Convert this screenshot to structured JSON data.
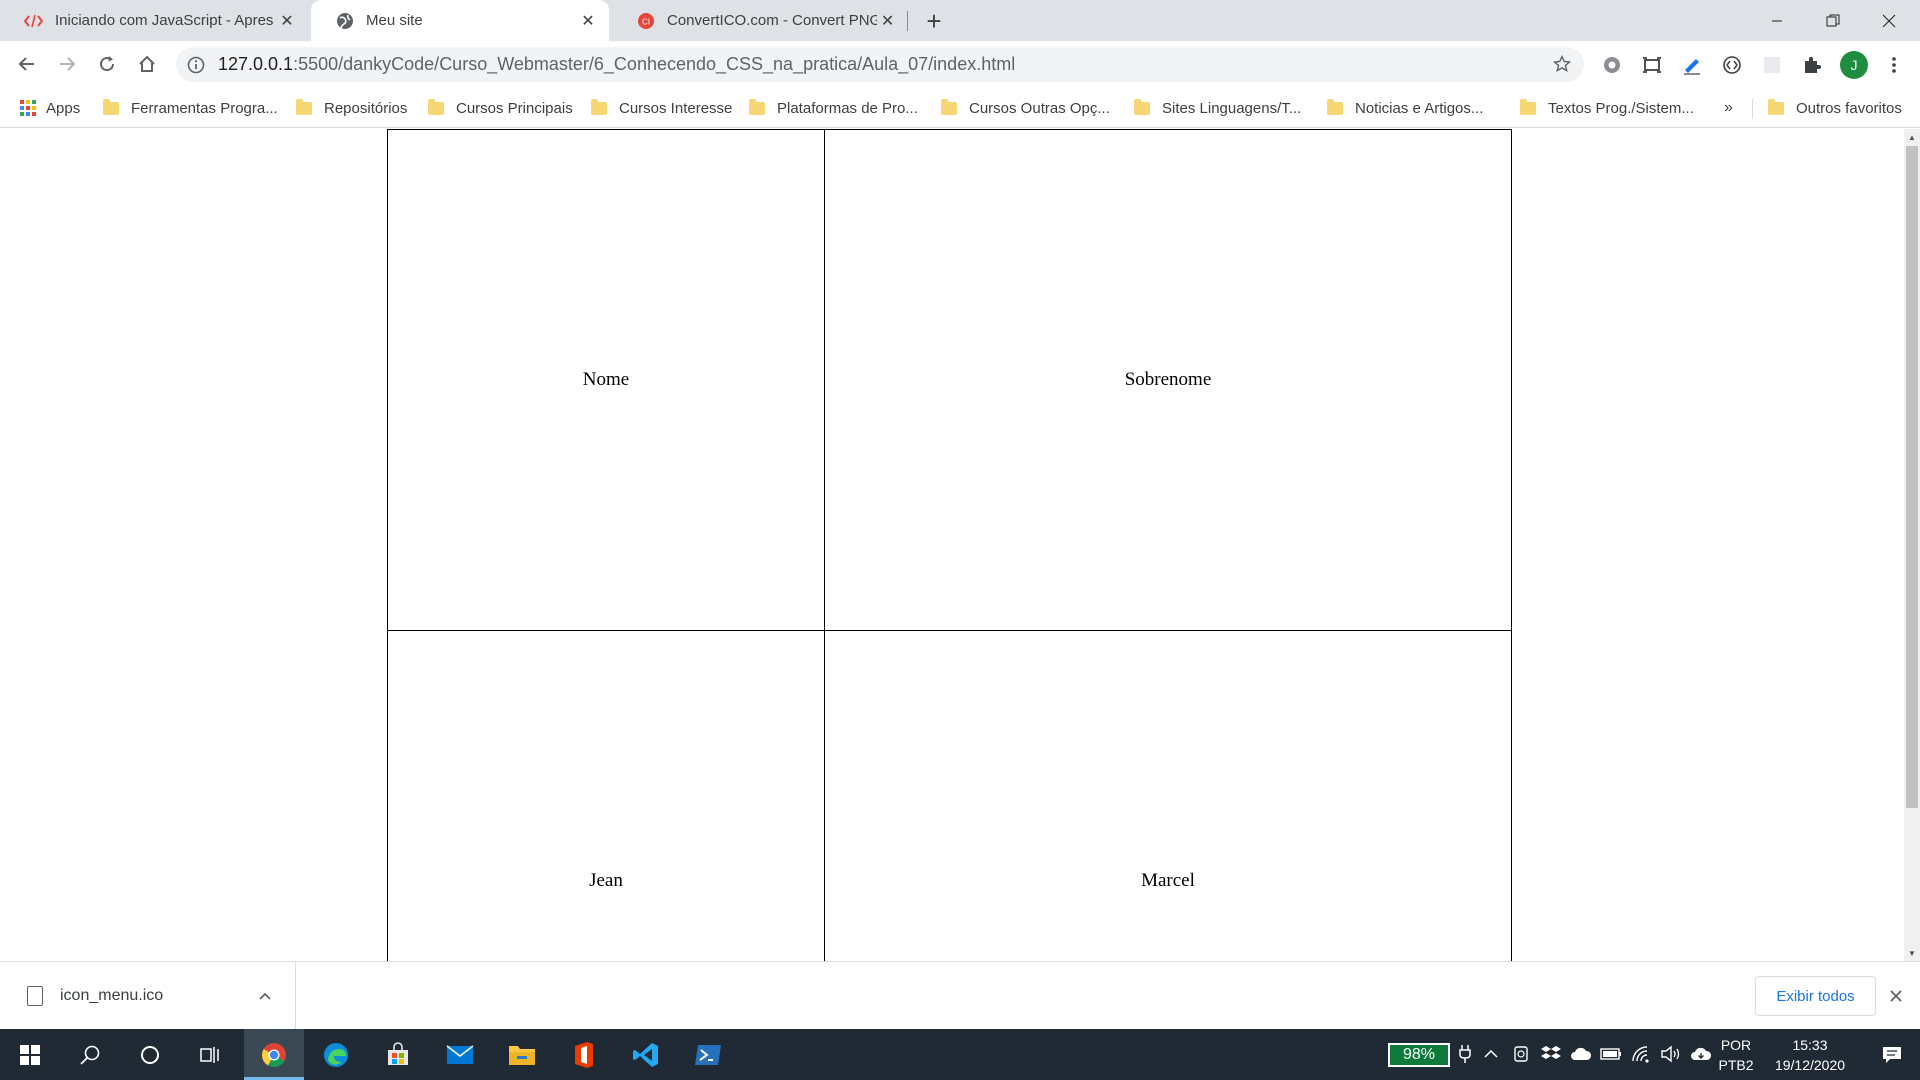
{
  "browser": {
    "tabs": [
      {
        "title": "Iniciando com JavaScript - Apres",
        "favicon": "code-brackets-icon",
        "active": false
      },
      {
        "title": "Meu site",
        "favicon": "globe-icon",
        "active": true
      },
      {
        "title": "ConvertICO.com - Convert PNG t",
        "favicon": "converticon-logo-icon",
        "active": false
      }
    ],
    "new_tab_label": "+",
    "url_host": "127.0.0.1",
    "url_rest": ":5500/dankyCode/Curso_Webmaster/6_Conhecendo_CSS_na_pratica/Aula_07/index.html",
    "profile_initial": "J",
    "bookmarks": {
      "apps_label": "Apps",
      "items": [
        "Ferramentas Progra...",
        "Repositórios",
        "Cursos Principais",
        "Cursos Interesse",
        "Plataformas de Pro...",
        "Cursos Outras Opç...",
        "Sites Linguagens/T...",
        "Noticias e Artigos...",
        "Textos Prog./Sistem..."
      ],
      "more_label": "»",
      "other_label": "Outros favoritos"
    }
  },
  "page": {
    "table": {
      "rows": [
        [
          "Nome",
          "Sobrenome"
        ],
        [
          "Jean",
          "Marcel"
        ]
      ]
    }
  },
  "downloads": {
    "file_name": "icon_menu.ico",
    "show_all_label": "Exibir todos"
  },
  "taskbar": {
    "battery": "98%",
    "language": "POR",
    "keyboard": "PTB2",
    "time": "15:33",
    "date": "19/12/2020"
  },
  "colors": {
    "tabstrip_bg": "#dee1e6",
    "accent_link": "#1a73e8",
    "taskbar_bg": "#1f2a34",
    "battery_bg": "#0f7b3a",
    "profile_bg": "#1e8e3e"
  }
}
